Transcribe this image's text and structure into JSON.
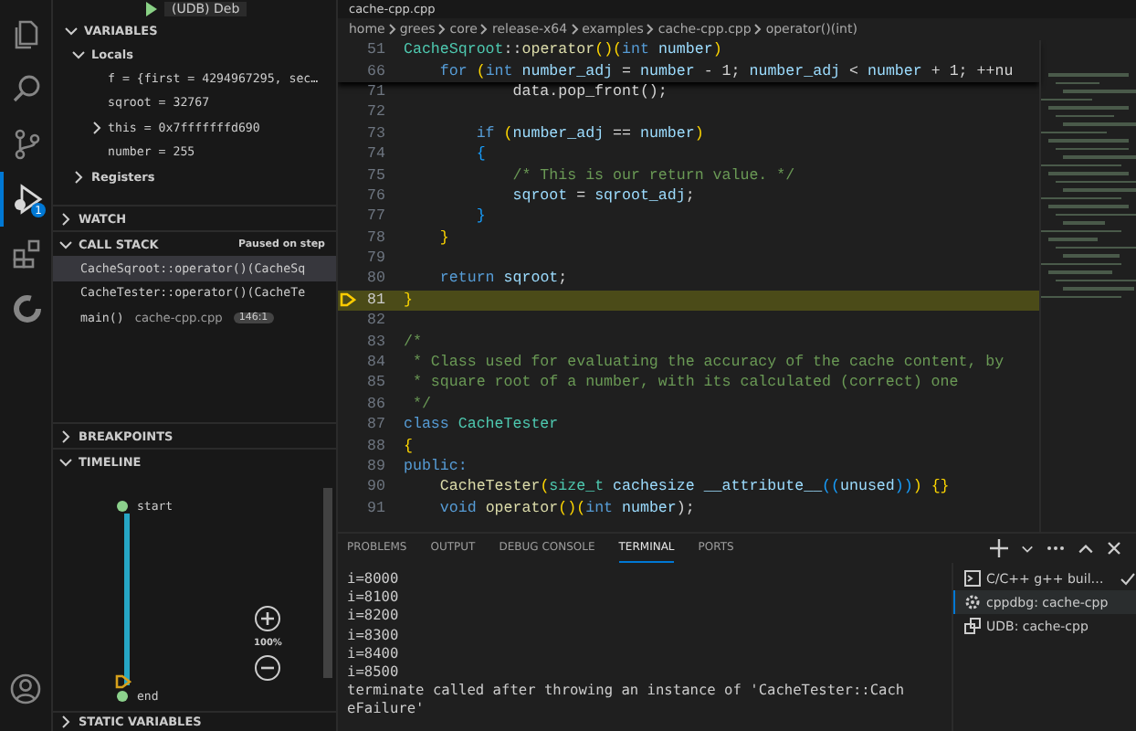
{
  "top_bar": {
    "debug_config": "(UDB) Deb",
    "editor_tab": "cache-cpp.cpp"
  },
  "activity_bar": [
    {
      "kind": "files",
      "selected": false
    },
    {
      "kind": "search",
      "selected": false
    },
    {
      "kind": "branch",
      "selected": false
    },
    {
      "kind": "debug",
      "selected": true,
      "badge": "1"
    },
    {
      "kind": "extensions",
      "selected": false
    },
    {
      "kind": "ring",
      "selected": false
    }
  ],
  "sidebar": {
    "variables": {
      "title": "VARIABLES",
      "expanded": true,
      "locals": {
        "label": "Locals",
        "expanded": true,
        "items": [
          {
            "text": "f = {first = 4294967295, sec…",
            "expandable": false
          },
          {
            "text": "sqroot = 32767",
            "expandable": false
          },
          {
            "text": "this = 0x7fffffffd690",
            "expandable": true
          },
          {
            "text": "number = 255",
            "expandable": false
          }
        ]
      },
      "registers": {
        "label": "Registers",
        "expanded": false
      }
    },
    "watch": {
      "title": "WATCH",
      "expanded": false
    },
    "call_stack": {
      "title": "CALL STACK",
      "expanded": true,
      "status": "Paused on step",
      "frames": [
        {
          "name": "CacheSqroot::operator()(CacheSq",
          "selected": true
        },
        {
          "name": "CacheTester::operator()(CacheTe",
          "selected": false
        },
        {
          "name": "main()",
          "file": "cache-cpp.cpp",
          "position": "146:1",
          "selected": false
        }
      ]
    },
    "breakpoints": {
      "title": "BREAKPOINTS",
      "expanded": false
    },
    "timeline": {
      "title": "TIMELINE",
      "expanded": true,
      "start": "start",
      "end": "end",
      "zoom": "100%"
    },
    "static_variables": {
      "title": "STATIC VARIABLES"
    }
  },
  "editor": {
    "breadcrumbs": [
      "home",
      "grees",
      "core",
      "release-x64",
      "examples",
      "cache-cpp.cpp",
      "operator()(int)"
    ],
    "sticky_lines": [
      {
        "num": "51",
        "tokens": [
          {
            "t": "CacheSqroot",
            "kind": "type"
          },
          {
            "t": "::",
            "kind": "plain"
          },
          {
            "t": "operator",
            "kind": "func"
          },
          {
            "t": "()(",
            "kind": "paren"
          },
          {
            "t": "int",
            "kind": "kw"
          },
          {
            "t": " number",
            "kind": "var"
          },
          {
            "t": ")",
            "kind": "paren"
          }
        ]
      },
      {
        "num": "66",
        "tokens": [
          {
            "t": "    for ",
            "kind": "kw"
          },
          {
            "t": "(",
            "kind": "paren"
          },
          {
            "t": "int",
            "kind": "kw"
          },
          {
            "t": " number_adj ",
            "kind": "var"
          },
          {
            "t": "= ",
            "kind": "plain"
          },
          {
            "t": "number ",
            "kind": "var"
          },
          {
            "t": "- 1; ",
            "kind": "plain"
          },
          {
            "t": "number_adj ",
            "kind": "var"
          },
          {
            "t": "< ",
            "kind": "plain"
          },
          {
            "t": "number ",
            "kind": "var"
          },
          {
            "t": "+ 1; ++nu",
            "kind": "plain"
          }
        ]
      }
    ],
    "lines": [
      {
        "num": "71",
        "current": false,
        "tokens": [
          {
            "t": "            data.pop_front();",
            "kind": "plain"
          }
        ]
      },
      {
        "num": "72",
        "current": false
      },
      {
        "num": "73",
        "current": false,
        "tokens": [
          {
            "t": "        if ",
            "kind": "kw"
          },
          {
            "t": "(",
            "kind": "paren"
          },
          {
            "t": "number_adj",
            "kind": "var"
          },
          {
            "t": " == ",
            "kind": "plain"
          },
          {
            "t": "number",
            "kind": "var"
          },
          {
            "t": ")",
            "kind": "paren"
          }
        ]
      },
      {
        "num": "74",
        "current": false,
        "tokens": [
          {
            "t": "        {",
            "kind": "brace"
          }
        ]
      },
      {
        "num": "75",
        "current": false,
        "tokens": [
          {
            "t": "            /* This is our return value. */",
            "kind": "comment"
          }
        ]
      },
      {
        "num": "76",
        "current": false,
        "tokens": [
          {
            "t": "            sqroot",
            "kind": "var"
          },
          {
            "t": " = ",
            "kind": "plain"
          },
          {
            "t": "sqroot_adj",
            "kind": "var"
          },
          {
            "t": ";",
            "kind": "plain"
          }
        ]
      },
      {
        "num": "77",
        "current": false,
        "tokens": [
          {
            "t": "        }",
            "kind": "brace"
          }
        ]
      },
      {
        "num": "78",
        "current": false,
        "tokens": [
          {
            "t": "    }",
            "kind": "paren"
          }
        ]
      },
      {
        "num": "79",
        "current": false
      },
      {
        "num": "80",
        "current": false,
        "tokens": [
          {
            "t": "    return ",
            "kind": "kw"
          },
          {
            "t": "sqroot",
            "kind": "var"
          },
          {
            "t": ";",
            "kind": "plain"
          }
        ]
      },
      {
        "num": "81",
        "current": true,
        "tokens": [
          {
            "t": "}",
            "kind": "paren"
          }
        ]
      },
      {
        "num": "82",
        "current": false
      },
      {
        "num": "83",
        "current": false,
        "tokens": [
          {
            "t": "/*",
            "kind": "comment"
          }
        ]
      },
      {
        "num": "84",
        "current": false,
        "tokens": [
          {
            "t": " * Class used for evaluating the accuracy of the cache content, by",
            "kind": "comment"
          }
        ]
      },
      {
        "num": "85",
        "current": false,
        "tokens": [
          {
            "t": " * square root of a number, with its calculated (correct) one",
            "kind": "comment"
          }
        ]
      },
      {
        "num": "86",
        "current": false,
        "tokens": [
          {
            "t": " */",
            "kind": "comment"
          }
        ]
      },
      {
        "num": "87",
        "current": false,
        "tokens": [
          {
            "t": "class ",
            "kind": "kw"
          },
          {
            "t": "CacheTester",
            "kind": "type"
          }
        ]
      },
      {
        "num": "88",
        "current": false,
        "tokens": [
          {
            "t": "{",
            "kind": "paren"
          }
        ]
      },
      {
        "num": "89",
        "current": false,
        "tokens": [
          {
            "t": "public:",
            "kind": "kw"
          }
        ]
      },
      {
        "num": "90",
        "current": false,
        "tokens": [
          {
            "t": "    CacheTester",
            "kind": "func"
          },
          {
            "t": "(",
            "kind": "paren"
          },
          {
            "t": "size_t",
            "kind": "type"
          },
          {
            "t": " cachesize __attribute__",
            "kind": "var"
          },
          {
            "t": "((",
            "kind": "brace"
          },
          {
            "t": "unused",
            "kind": "var"
          },
          {
            "t": "))",
            "kind": "brace"
          },
          {
            "t": ") {}",
            "kind": "paren"
          }
        ]
      },
      {
        "num": "91",
        "current": false,
        "tokens": [
          {
            "t": "    void ",
            "kind": "kw"
          },
          {
            "t": "operator",
            "kind": "func"
          },
          {
            "t": "()(",
            "kind": "paren"
          },
          {
            "t": "int",
            "kind": "kw"
          },
          {
            "t": " number",
            "kind": "var"
          },
          {
            "t": ");",
            "kind": "plain"
          }
        ]
      }
    ]
  },
  "panel": {
    "tabs": [
      {
        "label": "PROBLEMS",
        "selected": false
      },
      {
        "label": "OUTPUT",
        "selected": false
      },
      {
        "label": "DEBUG CONSOLE",
        "selected": false
      },
      {
        "label": "TERMINAL",
        "selected": true
      },
      {
        "label": "PORTS",
        "selected": false
      }
    ],
    "terminal_lines": [
      "i=8000",
      "i=8100",
      "i=8200",
      "i=8300",
      "i=8400",
      "i=8500",
      "terminate called after throwing an instance of 'CacheTester::Cach",
      "eFailure'"
    ],
    "terminals": [
      {
        "label": "C/C++ g++ buil…",
        "kind": "task",
        "done": true,
        "selected": false
      },
      {
        "label": "cppdbg: cache-cpp",
        "kind": "debug",
        "done": false,
        "selected": true
      },
      {
        "label": "UDB: cache-cpp",
        "kind": "remote",
        "done": false,
        "selected": false
      }
    ]
  }
}
